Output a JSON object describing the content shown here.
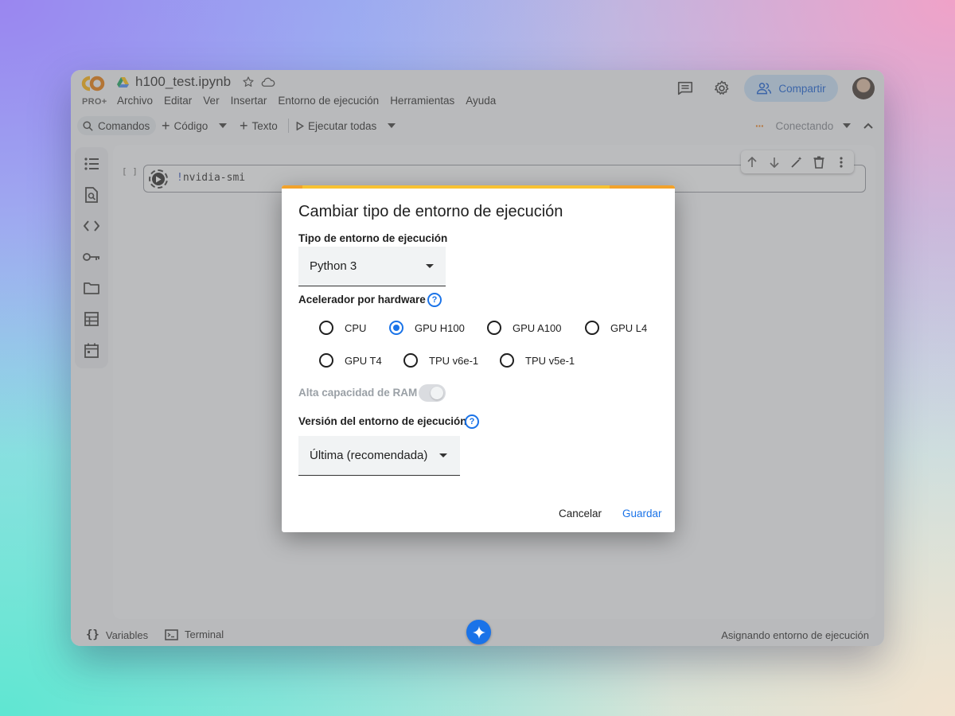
{
  "app": {
    "logo_text": "CO",
    "plan_badge": "PRO+",
    "file_name": "h100_test.ipynb",
    "menu": [
      "Archivo",
      "Editar",
      "Ver",
      "Insertar",
      "Entorno de ejecución",
      "Herramientas",
      "Ayuda"
    ],
    "share_label": "Compartir"
  },
  "toolbar": {
    "commands_label": "Comandos",
    "code_label": "Código",
    "text_label": "Texto",
    "run_all_label": "Ejecutar todas",
    "connection_status": "Conectando"
  },
  "cell": {
    "brackets": "[ ]",
    "code_bang": "!",
    "code_rest": "nvidia-smi"
  },
  "statusbar": {
    "variables_label": "Variables",
    "terminal_label": "Terminal",
    "status": "Asignando entorno de ejecución"
  },
  "dialog": {
    "title": "Cambiar tipo de entorno de ejecución",
    "runtime_type_label": "Tipo de entorno de ejecución",
    "runtime_type_value": "Python 3",
    "accelerator_label": "Acelerador por hardware",
    "accelerators": [
      {
        "label": "CPU",
        "checked": false
      },
      {
        "label": "GPU H100",
        "checked": true
      },
      {
        "label": "GPU A100",
        "checked": false
      },
      {
        "label": "GPU L4",
        "checked": false
      },
      {
        "label": "GPU T4",
        "checked": false
      },
      {
        "label": "TPU v6e-1",
        "checked": false
      },
      {
        "label": "TPU v5e-1",
        "checked": false
      }
    ],
    "high_ram_label": "Alta capacidad de RAM",
    "high_ram_enabled": false,
    "version_label": "Versión del entorno de ejecución",
    "version_value": "Última (recomendada)",
    "cancel_label": "Cancelar",
    "save_label": "Guardar",
    "help_glyph": "?"
  },
  "colors": {
    "accent": "#1a73e8",
    "share_bg": "#c2dbf5",
    "dialog_bar": "#f2a22b"
  }
}
